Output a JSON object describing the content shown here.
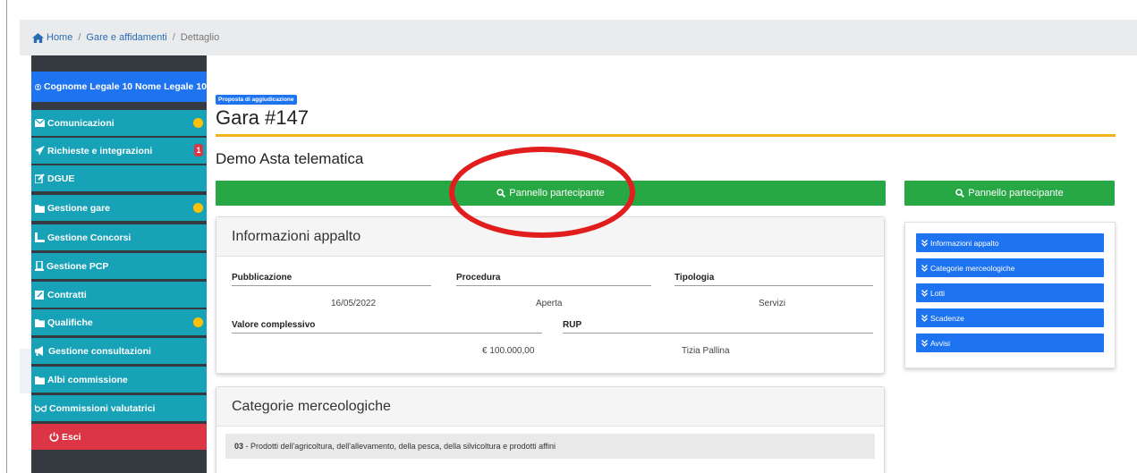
{
  "breadcrumb": {
    "home": "Home",
    "section": "Gare e affidamenti",
    "current": "Dettaglio"
  },
  "sidebar": {
    "user": "Cognome Legale 10 Nome Legale 10",
    "items": [
      {
        "label": "Comunicazioni",
        "icon": "envelope-icon",
        "indicator": "dot"
      },
      {
        "label": "Richieste e integrazioni",
        "icon": "paper-plane-icon",
        "indicator": "badge",
        "badge": "1"
      },
      {
        "label": "DGUE",
        "icon": "edit-icon"
      },
      {
        "label": "Gestione gare",
        "icon": "folder-icon",
        "indicator": "dot"
      },
      {
        "label": "Gestione Concorsi",
        "icon": "ruler-icon"
      },
      {
        "label": "Gestione PCP",
        "icon": "building-icon"
      },
      {
        "label": "Contratti",
        "icon": "edit-icon"
      },
      {
        "label": "Qualifiche",
        "icon": "folder-icon",
        "indicator": "dot"
      },
      {
        "label": "Gestione consultazioni",
        "icon": "megaphone-icon"
      },
      {
        "label": "Albi commissione",
        "icon": "folder-icon"
      },
      {
        "label": "Commissioni valutatrici",
        "icon": "glasses-icon"
      }
    ],
    "logout": "Esci"
  },
  "main": {
    "status_badge": "Proposta di aggiudicazione",
    "title": "Gara #147",
    "subtitle": "Demo Asta telematica",
    "panel_button": "Pannello partecipante",
    "info_card": {
      "title": "Informazioni appalto",
      "labels": {
        "pubblicazione": "Pubblicazione",
        "procedura": "Procedura",
        "tipologia": "Tipologia",
        "valore": "Valore complessivo",
        "rup": "RUP"
      },
      "values": {
        "pubblicazione": "16/05/2022",
        "procedura": "Aperta",
        "tipologia": "Servizi",
        "valore": "€ 100.000,00",
        "rup": "Tizia Pallina"
      }
    },
    "categories_card": {
      "title": "Categorie merceologiche",
      "row_code": "03",
      "row_text": " - Prodotti dell'agricoltura, dell'allevamento, della pesca, della silvicoltura e prodotti affini"
    }
  },
  "right_panel": {
    "button": "Pannello partecipante",
    "links": [
      "Informazioni appalto",
      "Categorie merceologiche",
      "Lotti",
      "Scadenze",
      "Avvisi"
    ]
  },
  "colors": {
    "sidebar_item": "#17a2b8",
    "user_bar": "#1e73f0",
    "logout": "#dc3545",
    "panel_button": "#28a745",
    "accent_rule": "#f2b21b",
    "annotation_ellipse": "#e11d1d"
  }
}
